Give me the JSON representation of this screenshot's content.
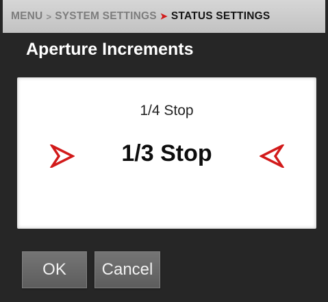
{
  "breadcrumb": {
    "items": [
      "MENU",
      "SYSTEM SETTINGS",
      "STATUS SETTINGS"
    ],
    "separator": ">"
  },
  "dialog": {
    "title": "Aperture Increments",
    "previous_option": "1/4 Stop",
    "selected_option": "1/3 Stop"
  },
  "buttons": {
    "ok_label": "OK",
    "cancel_label": "Cancel"
  },
  "icons": {
    "left": "chevron-right-outline-icon",
    "right": "chevron-left-outline-icon"
  },
  "colors": {
    "accent": "#d21a1a",
    "background": "#262626",
    "breadcrumb_bar": "#c8c8c8",
    "button": "#6b6b6b"
  }
}
